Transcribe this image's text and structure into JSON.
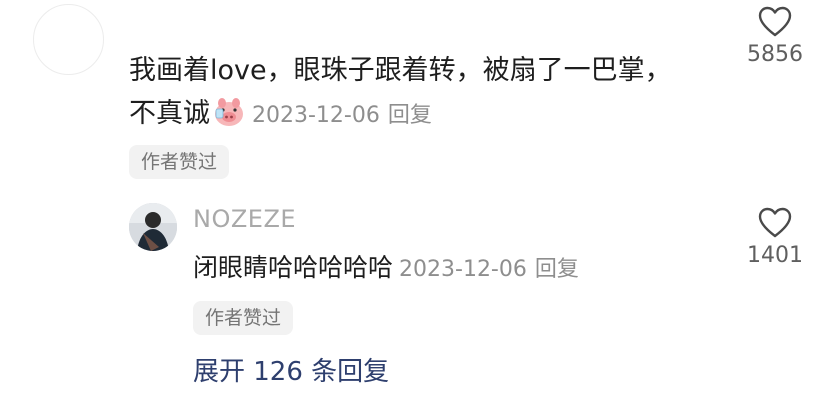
{
  "comment": {
    "text_line1": "我画着love，眼珠子跟着转，被扇了一巴掌，",
    "text_line2": "不真诚",
    "emoji": "pig-face-emoji",
    "date": "2023-12-06",
    "reply_label": "回复",
    "badge": "作者赞过",
    "likes": "5856"
  },
  "reply": {
    "username": "NOZEZE",
    "text": "闭眼睛哈哈哈哈哈",
    "date": "2023-12-06",
    "reply_label": "回复",
    "badge": "作者赞过",
    "likes": "1401"
  },
  "expand_label": "展开 126 条回复",
  "colors": {
    "text": "#1e1e1e",
    "meta": "#8e8e8e",
    "badge_bg": "#f2f2f2",
    "link": "#2e3f6e"
  }
}
